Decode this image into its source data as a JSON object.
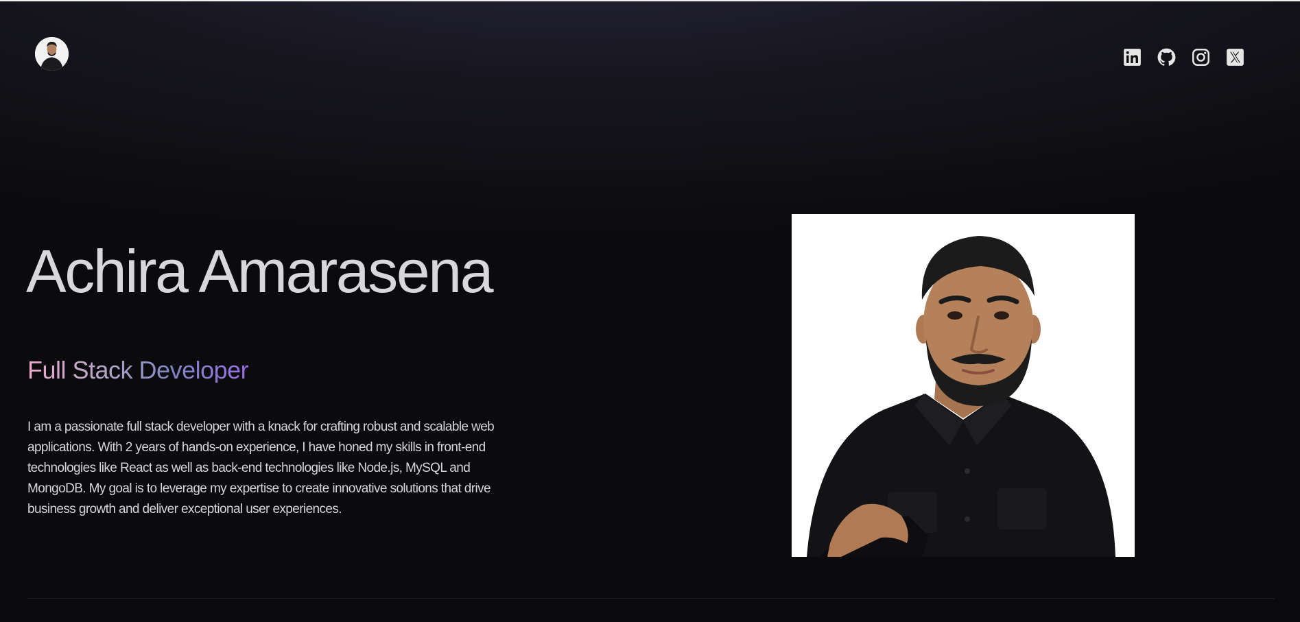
{
  "profile": {
    "name": "Achira Amarasena",
    "role": "Full Stack Developer",
    "bio": "I am a passionate full stack developer with a knack for crafting robust and scalable web applications. With 2 years of hands-on experience, I have honed my skills in front-end technologies like React as well as back-end technologies like Node.js, MySQL and MongoDB. My goal is to leverage my expertise to create innovative solutions that drive business growth and deliver exceptional user experiences."
  },
  "nav": {
    "avatar_icon": "profile-avatar",
    "social_links": [
      {
        "icon": "linkedin-icon"
      },
      {
        "icon": "github-icon"
      },
      {
        "icon": "instagram-icon"
      },
      {
        "icon": "x-twitter-icon"
      }
    ]
  },
  "hero_image": {
    "icon": "profile-photo"
  },
  "colors": {
    "background": "#0b0b0d",
    "text": "#d4d4d8",
    "role_gradient": [
      "#f0a9cf",
      "#b3a7c6",
      "#7f86c6",
      "#9a6ee6"
    ]
  }
}
